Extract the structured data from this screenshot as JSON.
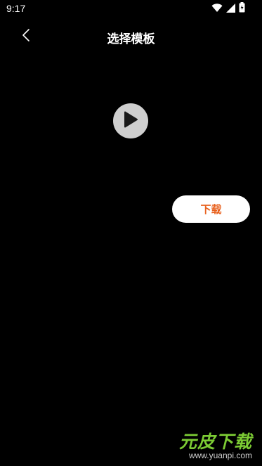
{
  "status_bar": {
    "time": "9:17",
    "icons": [
      "wifi-icon",
      "signal-icon",
      "battery-icon"
    ]
  },
  "header": {
    "title": "选择模板",
    "back_icon": "chevron-left-icon"
  },
  "preview": {
    "play_icon": "play-icon",
    "download_label": "下载"
  },
  "watermark": {
    "logo_text": "元皮下载",
    "url": "www.yuanpi.com"
  },
  "colors": {
    "background": "#000000",
    "accent": "#e8611e",
    "play_button": "#cfcfcf",
    "watermark_green": "#7ccb34"
  }
}
